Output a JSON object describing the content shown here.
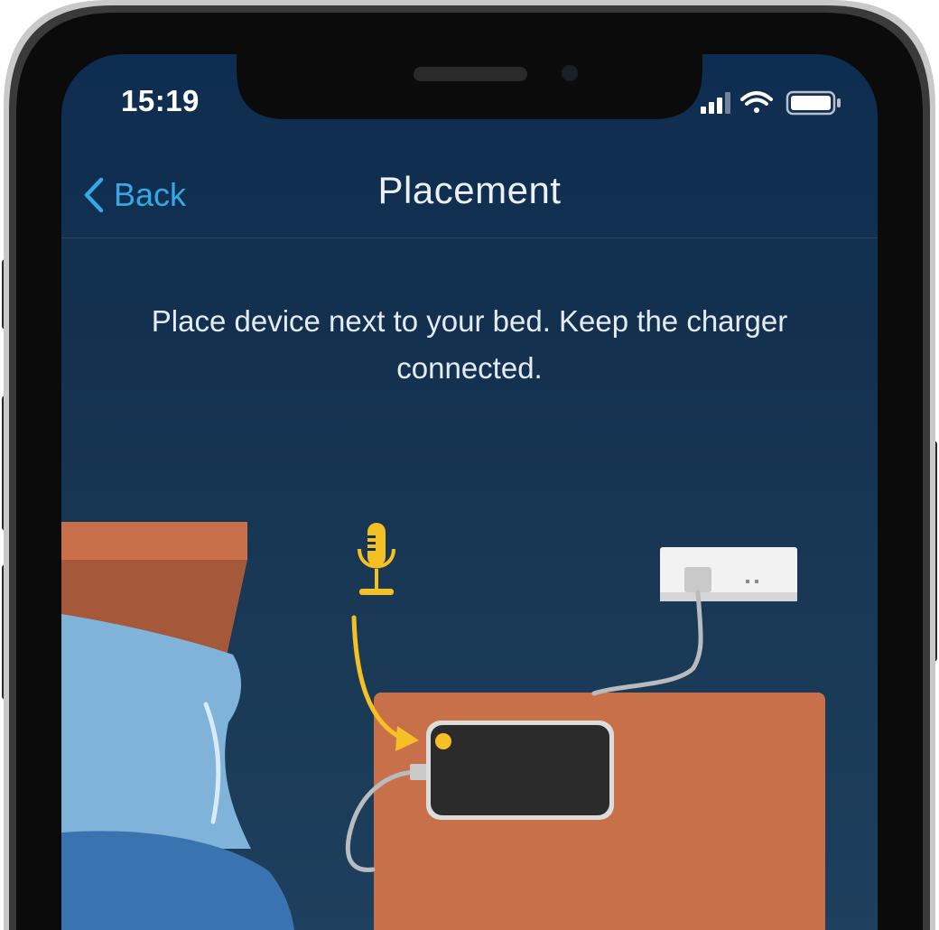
{
  "status_bar": {
    "time": "15:19",
    "icons": [
      "cellular-signal-icon",
      "wifi-icon",
      "battery-icon"
    ]
  },
  "navbar": {
    "back_label": "Back",
    "title": "Placement"
  },
  "instruction": {
    "text": "Place device next to your bed. Keep the charger connected."
  },
  "illustration": {
    "elements": [
      "bed",
      "pillow",
      "blanket",
      "nightstand",
      "device",
      "charger-cable",
      "wall-outlet",
      "microphone-icon",
      "arrow"
    ]
  },
  "colors": {
    "screen_bg_top": "#0e2e51",
    "screen_bg_bottom": "#1e3f5d",
    "accent_blue": "#36a8e4",
    "title_text": "#eaf0f6",
    "nightstand": "#c8704a",
    "headboard": "#c8704a",
    "pillow": "#7fb3d9",
    "blanket": "#3a74b0",
    "device": "#2b2b2b",
    "mic_yellow": "#f5c023",
    "outlet": "#f2f2f2",
    "cable": "#b9bcbf"
  }
}
